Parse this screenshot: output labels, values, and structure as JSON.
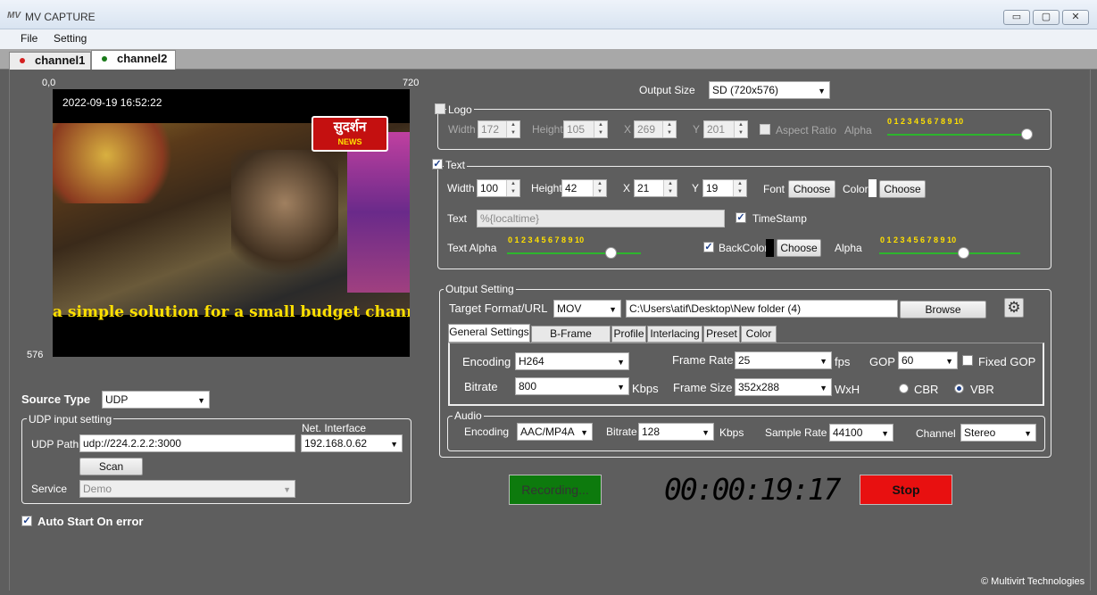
{
  "window": {
    "title": "MV CAPTURE",
    "app_icon_text": "MV",
    "min": "▭",
    "max": "▢",
    "close": "✕"
  },
  "menu": {
    "file": "File",
    "setting": "Setting"
  },
  "channel_tabs": [
    {
      "label": "channel1",
      "dot_color": "#d42020"
    },
    {
      "label": "channel2",
      "dot_color": "#1a7a1a"
    }
  ],
  "preview": {
    "corner_tl": "0,0",
    "corner_tr": "720",
    "corner_bl": "576",
    "timestamp": "2022-09-19 16:52:22",
    "logo_text": "सुदर्शन",
    "logo_sub": "NEWS",
    "ticker": "a simple solution for a small budget channe"
  },
  "source": {
    "type_label": "Source Type",
    "type_value": "UDP",
    "udp_group_label": "UDP input setting",
    "udp_path_label": "UDP Path",
    "udp_path_value": "udp://224.2.2.2:3000",
    "net_interface_label": "Net. Interface",
    "net_interface_value": "192.168.0.62",
    "scan_label": "Scan",
    "service_label": "Service",
    "service_value": "Demo",
    "auto_start_label": "Auto Start On error",
    "auto_start_checked": "✓"
  },
  "output_size": {
    "label": "Output Size",
    "value": "SD (720x576)"
  },
  "logo": {
    "label": "Logo",
    "width_label": "Width",
    "width": "172",
    "height_label": "Height",
    "height": "105",
    "x_label": "X",
    "x": "269",
    "y_label": "Y",
    "y": "201",
    "aspect_label": "Aspect Ratio",
    "alpha_label": "Alpha",
    "alpha_ticks": "0  1  2  3  4  5  6  7  8  9  10",
    "alpha_value": 10
  },
  "text": {
    "label": "Text",
    "checked": "✓",
    "width_label": "Width",
    "width": "100",
    "height_label": "Height",
    "height": "42",
    "x_label": "X",
    "x": "21",
    "y_label": "Y",
    "y": "19",
    "font_label": "Font",
    "font_button": "Choose",
    "color_label": "Color",
    "color_button": "Choose",
    "text_label": "Text",
    "text_value": "%{localtime}",
    "timestamp_label": "TimeStamp",
    "timestamp_checked": "✓",
    "text_alpha_label": "Text Alpha",
    "text_alpha_ticks": "0  1  2  3  4  5  6  7  8  9  10",
    "text_alpha_value": 8,
    "backcolor_label": "BackColor",
    "backcolor_checked": "✓",
    "backcolor_button": "Choose",
    "alpha_label": "Alpha",
    "alpha_ticks": "0  1  2  3  4  5  6  7  8  9  10",
    "alpha_value": 6
  },
  "output_setting": {
    "label": "Output Setting",
    "target_label": "Target Format/URL",
    "format": "MOV",
    "path": "C:\\Users\\atif\\Desktop\\New folder (4)",
    "browse": "Browse",
    "tabs": [
      "General Settings",
      "B-Frame settings",
      "Profile",
      "Interlacing",
      "Preset",
      "Color"
    ],
    "encoding_label": "Encoding",
    "encoding": "H264",
    "bitrate_label": "Bitrate",
    "bitrate": "800",
    "bitrate_unit": "Kbps",
    "frame_rate_label": "Frame Rate",
    "frame_rate": "25",
    "fps": "fps",
    "gop_label": "GOP",
    "gop": "60",
    "fixed_gop_label": "Fixed GOP",
    "frame_size_label": "Frame Size",
    "frame_size": "352x288",
    "wxh": "WxH",
    "cbr_label": "CBR",
    "vbr_label": "VBR"
  },
  "audio": {
    "label": "Audio",
    "encoding_label": "Encoding",
    "encoding": "AAC/MP4A",
    "bitrate_label": "Bitrate",
    "bitrate": "128",
    "bitrate_unit": "Kbps",
    "sample_rate_label": "Sample Rate",
    "sample_rate": "44100",
    "channel_label": "Channel",
    "channel": "Stereo"
  },
  "controls": {
    "recording_label": "Recording...",
    "timer": "00:00:19:17",
    "stop_label": "Stop",
    "recording_color": "#0d7a0d",
    "stop_color": "#e81010"
  },
  "footer": {
    "copyright": "© Multivirt Technologies"
  }
}
